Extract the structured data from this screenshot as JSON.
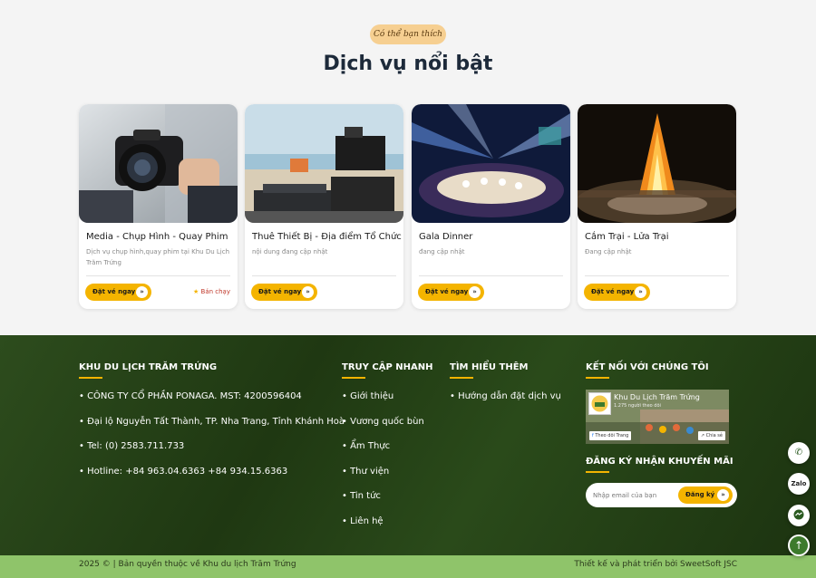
{
  "section": {
    "badge": "Có thể bạn thích",
    "title": "Dịch vụ nổi bật"
  },
  "services": [
    {
      "title": "Media - Chụp Hình - Quay Phim",
      "desc": "Dịch vụ chụp hình,quay phim tại Khu Du Lịch Trăm Trứng",
      "button": "Đặt vé ngay",
      "hot": "Bán chạy"
    },
    {
      "title": "Thuê Thiết Bị - Địa điểm Tổ Chức",
      "desc": "nội dung đang cập nhật",
      "button": "Đặt vé ngay"
    },
    {
      "title": "Gala Dinner",
      "desc": "đang cập nhật",
      "button": "Đặt vé ngay"
    },
    {
      "title": "Cắm Trại - Lửa Trại",
      "desc": "Đang cập nhật",
      "button": "Đặt vé ngay"
    }
  ],
  "footer": {
    "company": {
      "heading": "KHU DU LỊCH TRĂM TRỨNG",
      "lines": [
        "• CÔNG TY CỔ PHẦN PONAGA. MST: 4200596404",
        "• Đại lộ Nguyễn Tất Thành, TP. Nha Trang, Tỉnh Khánh Hoà",
        "• Tel: (0) 2583.711.733",
        "• Hotline: +84 963.04.6363 +84 934.15.6363"
      ]
    },
    "quick_access": {
      "heading": "TRUY CẬP NHANH",
      "links": [
        "• Giới thiệu",
        "• Vương quốc bùn",
        "• Ẩm Thực",
        "• Thư viện",
        "• Tin tức",
        "• Liên hệ"
      ]
    },
    "learn_more": {
      "heading": "TÌM HIỂU THÊM",
      "links": [
        "• Hướng dẫn đặt dịch vụ"
      ]
    },
    "connect": {
      "heading": "KẾT NỐI VỚI CHÚNG TÔI",
      "fb_name": "Khu Du Lịch Trăm Trứng",
      "fb_followers": "1.275 người theo dõi",
      "fb_follow": "Theo dõi Trang",
      "fb_share": "Chia sẻ"
    },
    "newsletter": {
      "heading": "ĐĂNG KÝ NHẬN KHUYẾN MÃI",
      "placeholder": "Nhập email của bạn",
      "button": "Đăng ký"
    },
    "copyright": "2025 © | Bản quyền thuộc về Khu du lịch Trăm Trứng",
    "credit": "Thiết kế và phát triển bởi SweetSoft JSC"
  },
  "floating": {
    "zalo": "Zalo"
  },
  "colors": {
    "accent": "#f4b400",
    "footer_bg": "#1f3812",
    "bottom_bar": "#8fc46a",
    "badge": "#f6cf91"
  }
}
